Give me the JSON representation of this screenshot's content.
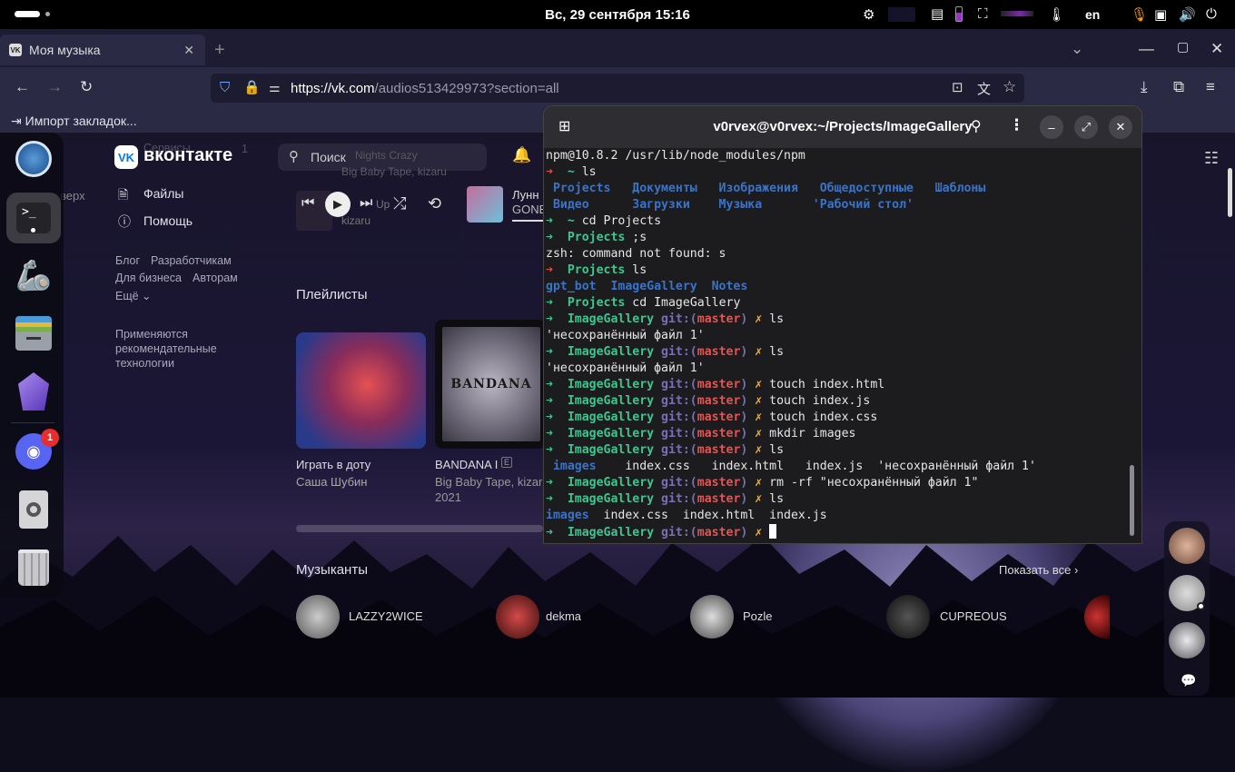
{
  "system": {
    "datetime": "Вс, 29 сентября  15:16",
    "keyboard_layout": "en"
  },
  "browser": {
    "tab_title": "Моя музыка",
    "url_host": "https://vk.com",
    "url_path": "/audios513429973?section=all",
    "bookmark_import": "Импорт закладок..."
  },
  "vk": {
    "logo_text": "вконтакте",
    "search_placeholder": "Поиск",
    "menu": {
      "services": "Сервисы",
      "services_badge": "1",
      "files": "Файлы",
      "help": "Помощь",
      "up": "верх"
    },
    "footer_links": [
      "Блог",
      "Разработчикам",
      "Для бизнеса",
      "Авторам",
      "Ещё"
    ],
    "footer_note": "Применяются рекомендательные технологии",
    "now_playing": {
      "ghost_title": "Nights Crazy",
      "artist": "Big Baby Tape, kizaru",
      "ghost_title2": "Up",
      "artist2": "kizaru",
      "next_title": "Лунн",
      "next_sub": "GONE"
    },
    "playlists_heading": "Плейлисты",
    "playlists": [
      {
        "title": "Играть в доту",
        "author": "Саша Шубин"
      },
      {
        "title": "BANDANA I",
        "author": "Big Baby Tape, kizar",
        "year": "2021",
        "explicit": "E",
        "cover_text": "BANDANA"
      }
    ],
    "musicians_heading": "Музыканты",
    "show_all": "Показать все",
    "musicians": [
      "LAZZY2WICE",
      "dekma",
      "Pozle",
      "CUPREOUS"
    ]
  },
  "terminal": {
    "title": "v0rvex@v0rvex:~/Projects/ImageGallery",
    "lines": [
      [
        {
          "t": "npm@10.8.2 /usr/lib/node_modules/npm",
          "c": ""
        }
      ],
      [
        {
          "t": "➜ ",
          "c": "r"
        },
        {
          "t": " ~ ",
          "c": "c"
        },
        {
          "t": "ls",
          "c": ""
        }
      ],
      [
        {
          "t": " Projects   Документы   Изображения   Общедоступные   Шаблоны",
          "c": "b"
        }
      ],
      [
        {
          "t": " Видео      Загрузки    Музыка       'Рабочий стол'",
          "c": "b"
        }
      ],
      [
        {
          "t": "➜ ",
          "c": "g"
        },
        {
          "t": " ~ ",
          "c": "c"
        },
        {
          "t": "cd Projects",
          "c": ""
        }
      ],
      [
        {
          "t": "➜ ",
          "c": "g"
        },
        {
          "t": " Projects ",
          "c": "c"
        },
        {
          "t": ";s",
          "c": ""
        }
      ],
      [
        {
          "t": "zsh: command not found: s",
          "c": ""
        }
      ],
      [
        {
          "t": "➜ ",
          "c": "r"
        },
        {
          "t": " Projects ",
          "c": "c"
        },
        {
          "t": "ls",
          "c": ""
        }
      ],
      [
        {
          "t": "gpt_bot  ImageGallery  Notes",
          "c": "b"
        }
      ],
      [
        {
          "t": "➜ ",
          "c": "g"
        },
        {
          "t": " Projects ",
          "c": "c"
        },
        {
          "t": "cd ImageGallery",
          "c": ""
        }
      ],
      [
        {
          "t": "➜ ",
          "c": "g"
        },
        {
          "t": " ImageGallery ",
          "c": "c"
        },
        {
          "t": "git:(",
          "c": "pur"
        },
        {
          "t": "master",
          "c": "red"
        },
        {
          "t": ")",
          "c": "pur"
        },
        {
          "t": " ✗ ",
          "c": "y"
        },
        {
          "t": "ls",
          "c": ""
        }
      ],
      [
        {
          "t": "'несохранённый файл 1'",
          "c": ""
        }
      ],
      [
        {
          "t": "➜ ",
          "c": "g"
        },
        {
          "t": " ImageGallery ",
          "c": "c"
        },
        {
          "t": "git:(",
          "c": "pur"
        },
        {
          "t": "master",
          "c": "red"
        },
        {
          "t": ")",
          "c": "pur"
        },
        {
          "t": " ✗ ",
          "c": "y"
        },
        {
          "t": "ls",
          "c": ""
        }
      ],
      [
        {
          "t": "'несохранённый файл 1'",
          "c": ""
        }
      ],
      [
        {
          "t": "➜ ",
          "c": "g"
        },
        {
          "t": " ImageGallery ",
          "c": "c"
        },
        {
          "t": "git:(",
          "c": "pur"
        },
        {
          "t": "master",
          "c": "red"
        },
        {
          "t": ")",
          "c": "pur"
        },
        {
          "t": " ✗ ",
          "c": "y"
        },
        {
          "t": "touch index.html",
          "c": ""
        }
      ],
      [
        {
          "t": "➜ ",
          "c": "g"
        },
        {
          "t": " ImageGallery ",
          "c": "c"
        },
        {
          "t": "git:(",
          "c": "pur"
        },
        {
          "t": "master",
          "c": "red"
        },
        {
          "t": ")",
          "c": "pur"
        },
        {
          "t": " ✗ ",
          "c": "y"
        },
        {
          "t": "touch index.js",
          "c": ""
        }
      ],
      [
        {
          "t": "➜ ",
          "c": "g"
        },
        {
          "t": " ImageGallery ",
          "c": "c"
        },
        {
          "t": "git:(",
          "c": "pur"
        },
        {
          "t": "master",
          "c": "red"
        },
        {
          "t": ")",
          "c": "pur"
        },
        {
          "t": " ✗ ",
          "c": "y"
        },
        {
          "t": "touch index.css",
          "c": ""
        }
      ],
      [
        {
          "t": "➜ ",
          "c": "g"
        },
        {
          "t": " ImageGallery ",
          "c": "c"
        },
        {
          "t": "git:(",
          "c": "pur"
        },
        {
          "t": "master",
          "c": "red"
        },
        {
          "t": ")",
          "c": "pur"
        },
        {
          "t": " ✗ ",
          "c": "y"
        },
        {
          "t": "mkdir images",
          "c": ""
        }
      ],
      [
        {
          "t": "➜ ",
          "c": "g"
        },
        {
          "t": " ImageGallery ",
          "c": "c"
        },
        {
          "t": "git:(",
          "c": "pur"
        },
        {
          "t": "master",
          "c": "red"
        },
        {
          "t": ")",
          "c": "pur"
        },
        {
          "t": " ✗ ",
          "c": "y"
        },
        {
          "t": "ls",
          "c": ""
        }
      ],
      [
        {
          "t": " images",
          "c": "b"
        },
        {
          "t": "    index.css   index.html   index.js  'несохранённый файл 1'",
          "c": ""
        }
      ],
      [
        {
          "t": "➜ ",
          "c": "g"
        },
        {
          "t": " ImageGallery ",
          "c": "c"
        },
        {
          "t": "git:(",
          "c": "pur"
        },
        {
          "t": "master",
          "c": "red"
        },
        {
          "t": ")",
          "c": "pur"
        },
        {
          "t": " ✗ ",
          "c": "y"
        },
        {
          "t": "rm -rf \"несохранённый файл 1\"",
          "c": ""
        }
      ],
      [
        {
          "t": "➜ ",
          "c": "g"
        },
        {
          "t": " ImageGallery ",
          "c": "c"
        },
        {
          "t": "git:(",
          "c": "pur"
        },
        {
          "t": "master",
          "c": "red"
        },
        {
          "t": ")",
          "c": "pur"
        },
        {
          "t": " ✗ ",
          "c": "y"
        },
        {
          "t": "ls",
          "c": ""
        }
      ],
      [
        {
          "t": "images",
          "c": "b"
        },
        {
          "t": "  index.css  index.html  index.js",
          "c": ""
        }
      ],
      [
        {
          "t": "➜ ",
          "c": "g"
        },
        {
          "t": " ImageGallery ",
          "c": "c"
        },
        {
          "t": "git:(",
          "c": "pur"
        },
        {
          "t": "master",
          "c": "red"
        },
        {
          "t": ")",
          "c": "pur"
        },
        {
          "t": " ✗ ",
          "c": "y"
        }
      ]
    ]
  },
  "dock": {
    "discord_badge": "1"
  },
  "colors": {
    "terminal_bg": "#1c1c1f",
    "prompt_green": "#3fc58f",
    "dir_blue": "#3b73c6",
    "accent_orange": "#f39c12"
  }
}
